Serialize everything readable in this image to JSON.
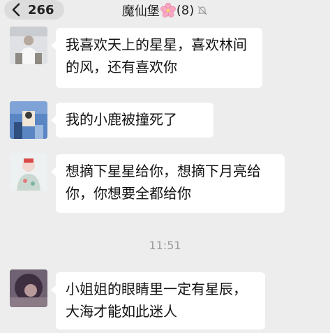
{
  "header": {
    "back_count": "266",
    "title": "魔仙堡",
    "member_count": "(8)",
    "icons": {
      "back": "chevron-left-icon",
      "flower": "cherry-blossom-icon",
      "mute": "bell-muted-icon"
    }
  },
  "messages": [
    {
      "text": "我喜欢天上的星星，喜欢林间的风，还有喜欢你"
    },
    {
      "text": "我的小鹿被撞死了"
    },
    {
      "text": "想摘下星星给你，想摘下月亮给你，你想要全都给你"
    },
    {
      "text": "小姐姐的眼睛里一定有星辰，大海才能如此迷人"
    }
  ],
  "timestamp": "11:51",
  "colors": {
    "background": "#ededed",
    "bubble": "#ffffff",
    "timestamp": "#9a9a9a"
  }
}
